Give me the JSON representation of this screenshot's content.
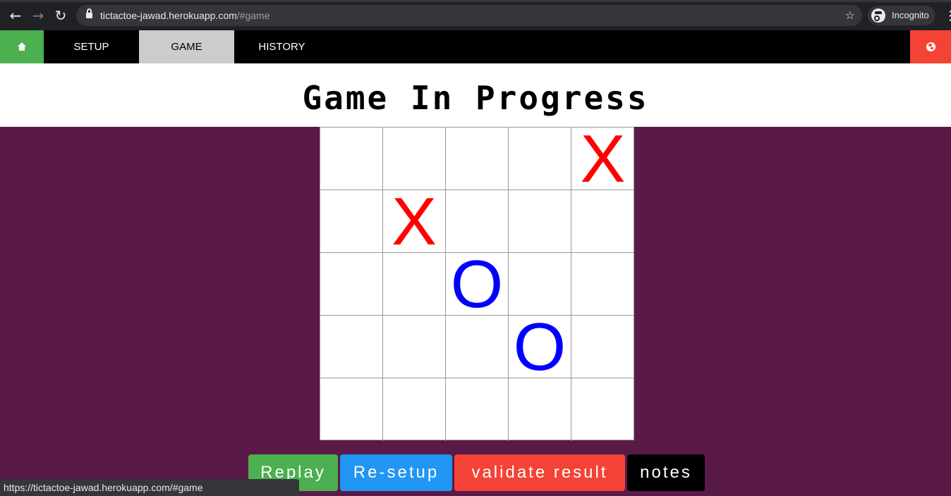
{
  "browser": {
    "url_host": "tictactoe-jawad.herokuapp.com",
    "url_path": "/#game",
    "profile_label": "Incognito",
    "status_url": "https://tictactoe-jawad.herokuapp.com/#game"
  },
  "nav": {
    "tabs": [
      {
        "label": "SETUP",
        "active": false
      },
      {
        "label": "GAME",
        "active": true
      },
      {
        "label": "HISTORY",
        "active": false
      }
    ]
  },
  "page": {
    "title": "Game In Progress"
  },
  "board": {
    "cells": [
      [
        "",
        "",
        "",
        "",
        "X"
      ],
      [
        "",
        "X",
        "",
        "",
        ""
      ],
      [
        "",
        "",
        "O",
        "",
        ""
      ],
      [
        "",
        "",
        "",
        "O",
        ""
      ],
      [
        "",
        "",
        "",
        "",
        ""
      ]
    ]
  },
  "actions": {
    "replay": "Replay",
    "resetup": "Re-setup",
    "validate": "validate result",
    "notes": "notes"
  },
  "colors": {
    "x_mark": "#ff0000",
    "o_mark": "#0000ff",
    "background": "#5a1a48",
    "replay": "#4caf50",
    "resetup": "#2196f3",
    "validate": "#f44336",
    "notes": "#000000"
  }
}
